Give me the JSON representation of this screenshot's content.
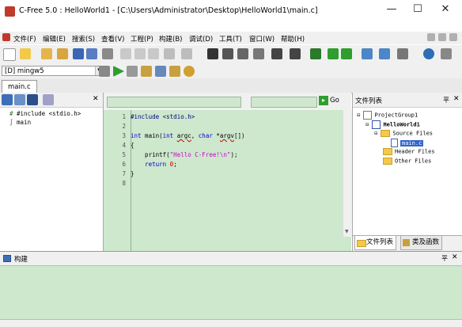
{
  "window": {
    "title": "C-Free 5.0 : HelloWorld1 - [C:\\Users\\Administrator\\Desktop\\HelloWorld1\\main.c]",
    "minimize_glyph": "—",
    "maximize_glyph": "☐",
    "close_glyph": "✕"
  },
  "menu": {
    "items": [
      "文件(F)",
      "编辑(E)",
      "搜索(S)",
      "查看(V)",
      "工程(P)",
      "构建(B)",
      "调试(D)",
      "工具(T)",
      "窗口(W)",
      "帮助(H)"
    ]
  },
  "toolbar2": {
    "compiler": "[D] mingw5"
  },
  "tabs": [
    "main.c"
  ],
  "left_panel": {
    "close_glyph": "✕",
    "items": [
      "#include <stdio.h>",
      "main"
    ]
  },
  "editor": {
    "go_label": "Go",
    "line_numbers": [
      "1",
      "2",
      "3",
      "4",
      "5",
      "6",
      "7",
      "8"
    ]
  },
  "right_panel": {
    "title": "文件列表",
    "pin_glyph": "平",
    "close_glyph": "✕",
    "tree": {
      "group": "ProjectGroup1",
      "project": "HelloWorld1",
      "source_folder": "Source Files",
      "source_file": "main.c",
      "header_folder": "Header Files",
      "other_folder": "Other Files"
    },
    "tabs": [
      "文件列表",
      "类及函数"
    ]
  },
  "build_panel": {
    "title": "构建",
    "pin_glyph": "平",
    "close_glyph": "✕"
  },
  "colors": {
    "editor_bg": "#cde8cd",
    "keyword": "#0000cc",
    "string": "#cc00cc"
  }
}
